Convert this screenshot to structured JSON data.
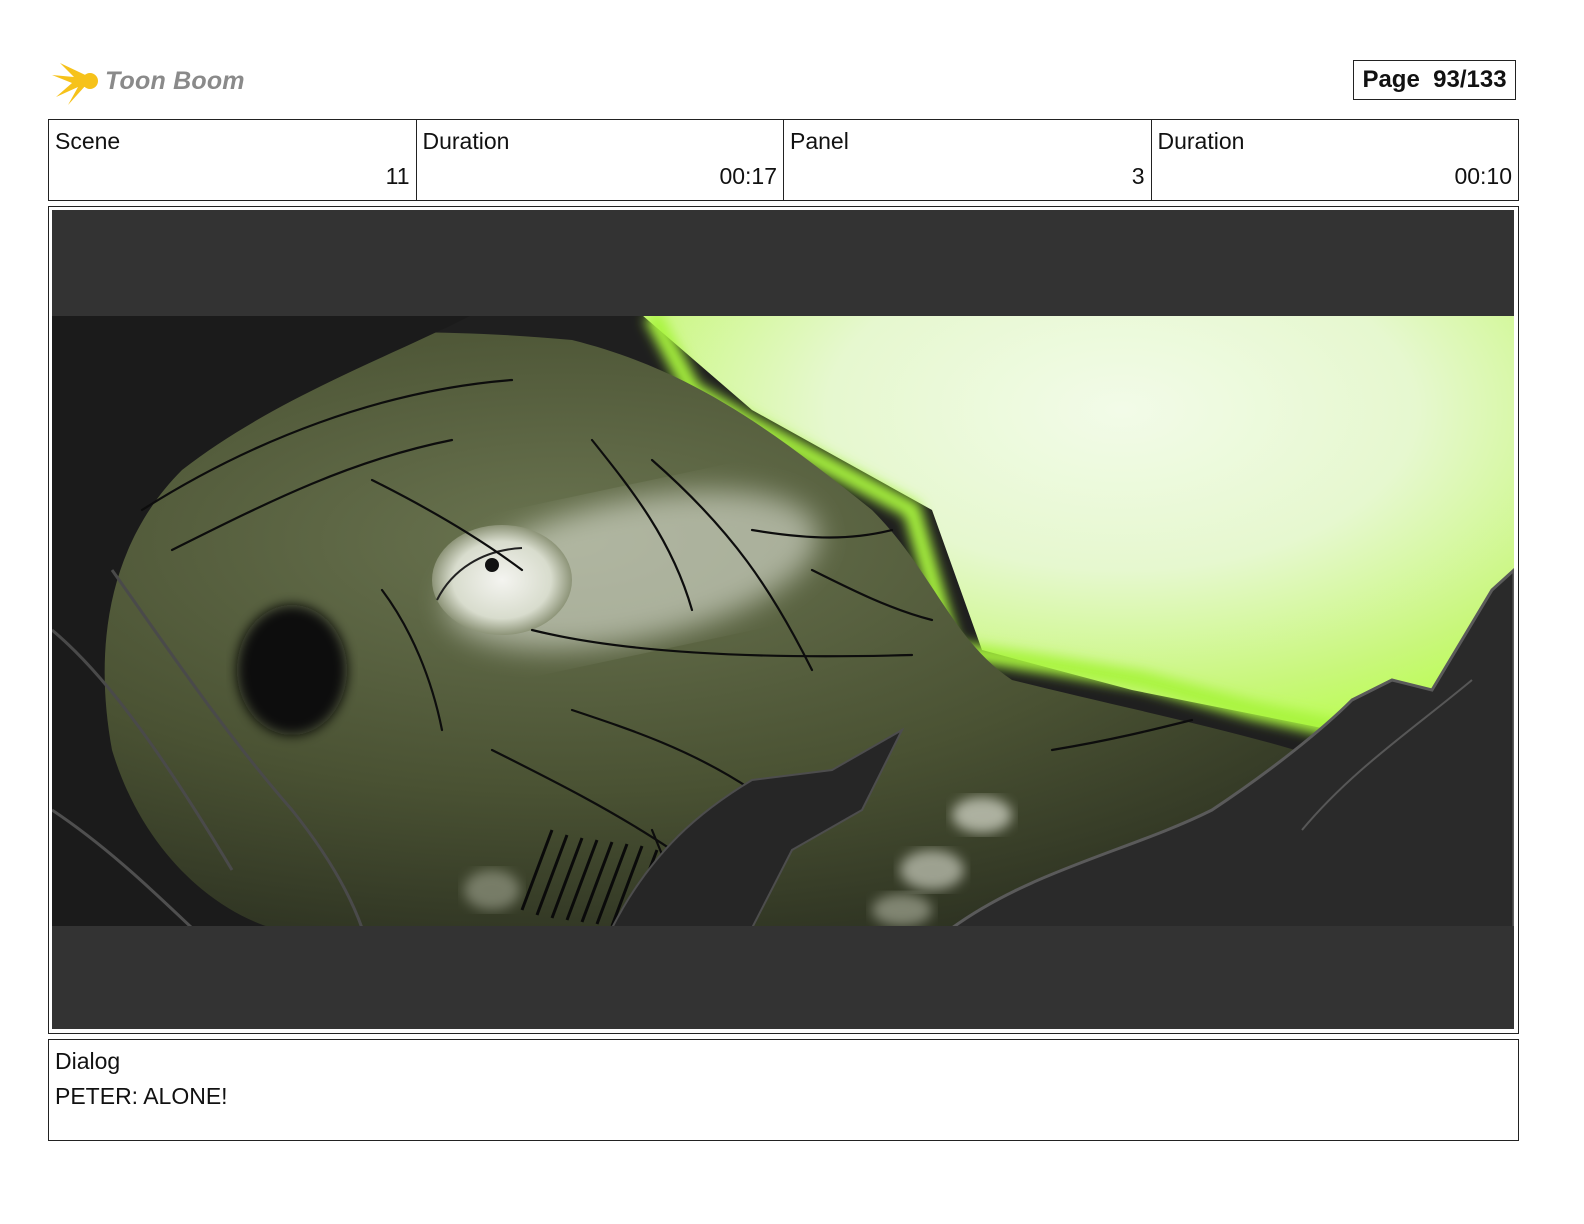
{
  "header": {
    "logo_text": "Toon Boom",
    "page_label": "Page",
    "page_value": "93/133"
  },
  "info": {
    "scene_label": "Scene",
    "scene_value": "11",
    "scene_duration_label": "Duration",
    "scene_duration_value": "00:17",
    "panel_label": "Panel",
    "panel_value": "3",
    "panel_duration_label": "Duration",
    "panel_duration_value": "00:10"
  },
  "dialog": {
    "label": "Dialog",
    "text": "PETER: ALONE!"
  },
  "colors": {
    "letterbox": "#333333",
    "glow": "#b8ff4a",
    "skin": "#4a5233",
    "dark": "#1e1e1e"
  }
}
